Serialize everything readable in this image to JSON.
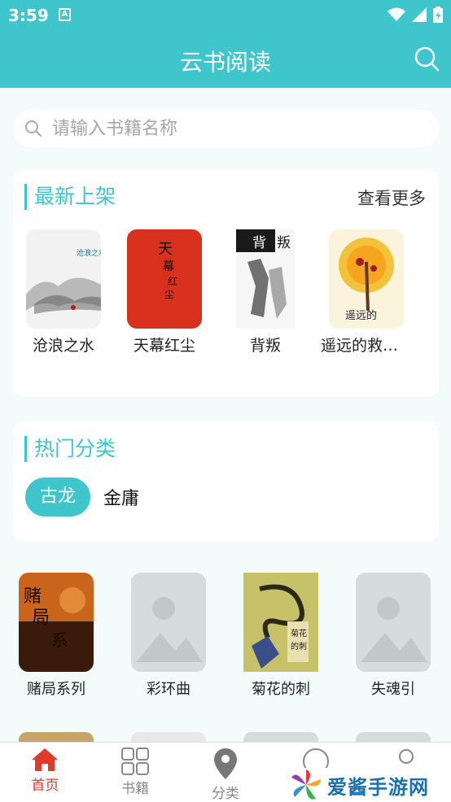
{
  "status": {
    "time": "3:59",
    "notif_icon": "A"
  },
  "appbar": {
    "title": "云书阅读"
  },
  "search": {
    "placeholder": "请输入书籍名称"
  },
  "latest": {
    "title": "最新上架",
    "more": "查看更多",
    "books": [
      {
        "name": "沧浪之水"
      },
      {
        "name": "天幕红尘"
      },
      {
        "name": "背叛"
      },
      {
        "name": "遥远的救世主"
      }
    ]
  },
  "categories": {
    "title": "热门分类",
    "active": "古龙",
    "other": "金庸"
  },
  "grid": [
    {
      "name": "赌局系列"
    },
    {
      "name": "彩环曲"
    },
    {
      "name": "菊花的刺"
    },
    {
      "name": "失魂引"
    }
  ],
  "nav": [
    {
      "label": "首页"
    },
    {
      "label": "书籍"
    },
    {
      "label": "分类"
    },
    {
      "label": ""
    },
    {
      "label": ""
    }
  ],
  "watermark": {
    "text": "爱酱手游网"
  },
  "colors": {
    "accent": "#3ec6cc",
    "active_tab": "#e03a2a"
  }
}
